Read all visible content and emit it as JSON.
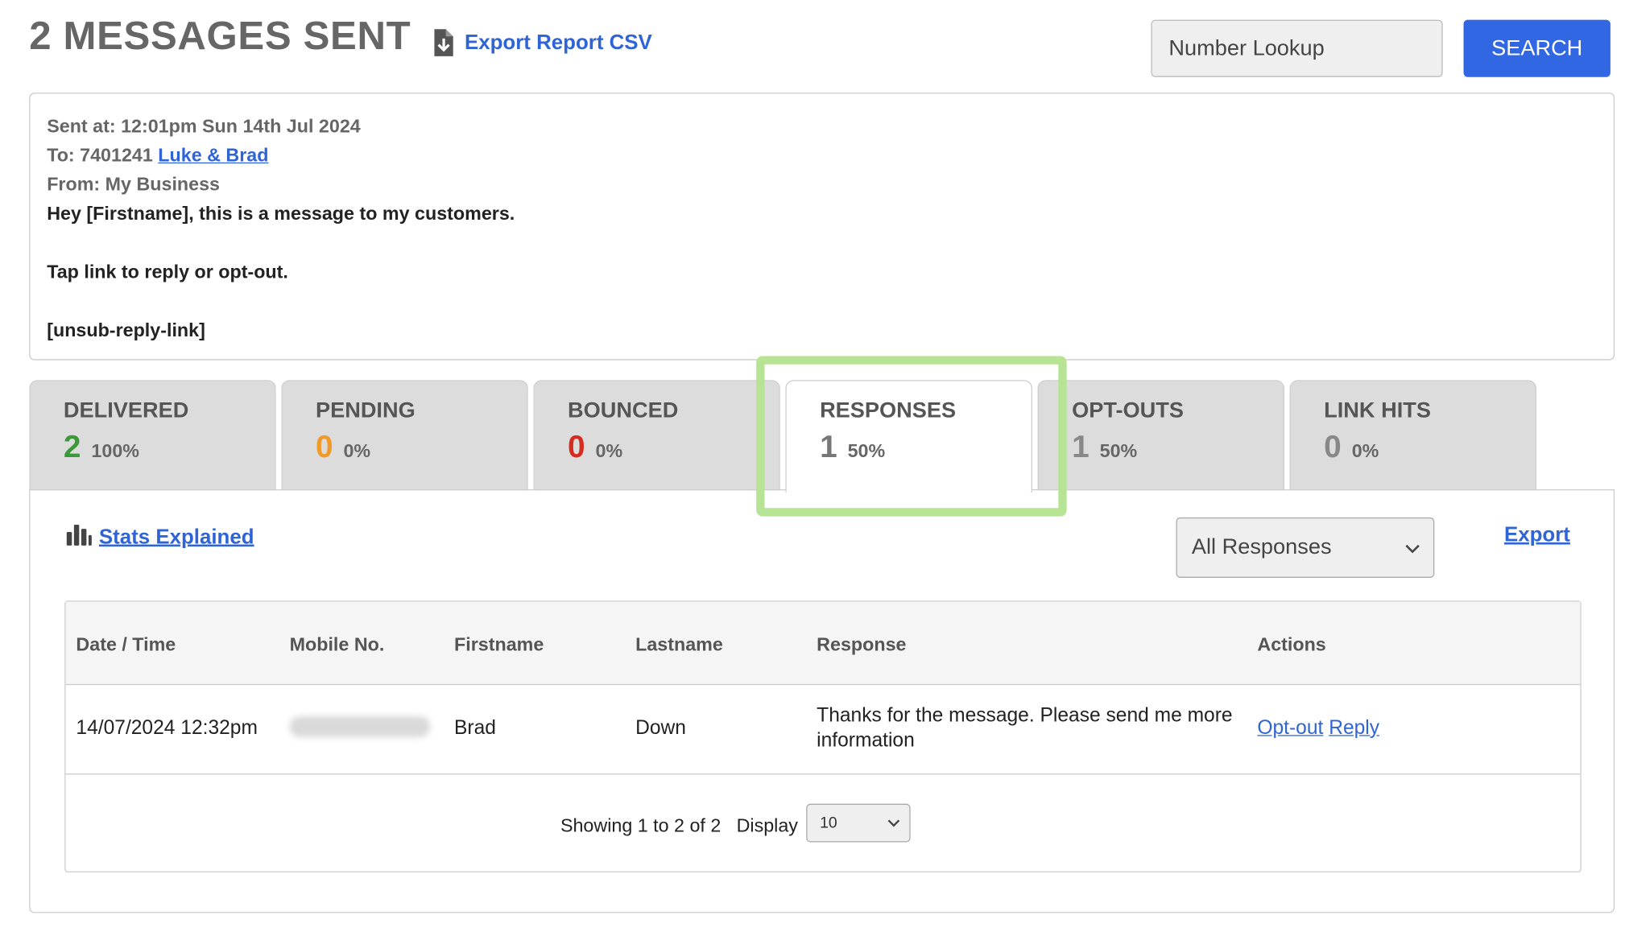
{
  "header": {
    "title": "2 MESSAGES SENT",
    "export_csv_label": "Export Report CSV",
    "lookup_placeholder": "Number Lookup",
    "search_label": "SEARCH"
  },
  "message": {
    "sent_at": "Sent at: 12:01pm Sun 14th Jul 2024",
    "to_prefix": "To: 7401241",
    "to_link": "Luke & Brad",
    "from": "From: My Business",
    "line1": "Hey [Firstname], this is a message to my customers.",
    "line2": "Tap link to reply or opt-out.",
    "line3": "[unsub-reply-link]"
  },
  "tabs": [
    {
      "label": "DELIVERED",
      "count": "2",
      "pct": "100%",
      "color": "#3a9a3a"
    },
    {
      "label": "PENDING",
      "count": "0",
      "pct": "0%",
      "color": "#f09a2a"
    },
    {
      "label": "BOUNCED",
      "count": "0",
      "pct": "0%",
      "color": "#d62b1f"
    },
    {
      "label": "RESPONSES",
      "count": "1",
      "pct": "50%",
      "color": "#777777"
    },
    {
      "label": "OPT-OUTS",
      "count": "1",
      "pct": "50%",
      "color": "#888888"
    },
    {
      "label": "LINK HITS",
      "count": "0",
      "pct": "0%",
      "color": "#888888"
    }
  ],
  "active_tab": "RESPONSES",
  "panel": {
    "stats_link": "Stats Explained",
    "filter_value": "All Responses",
    "export_label": "Export"
  },
  "table": {
    "headers": [
      "Date / Time",
      "Mobile No.",
      "Firstname",
      "Lastname",
      "Response",
      "Actions"
    ],
    "rows": [
      {
        "datetime": "14/07/2024 12:32pm",
        "firstname": "Brad",
        "lastname": "Down",
        "response": "Thanks for the message. Please send me more information",
        "action_optout": "Opt-out",
        "action_reply": "Reply"
      }
    ],
    "showing": "Showing 1 to 2 of 2",
    "display_label": "Display",
    "display_value": "10"
  }
}
